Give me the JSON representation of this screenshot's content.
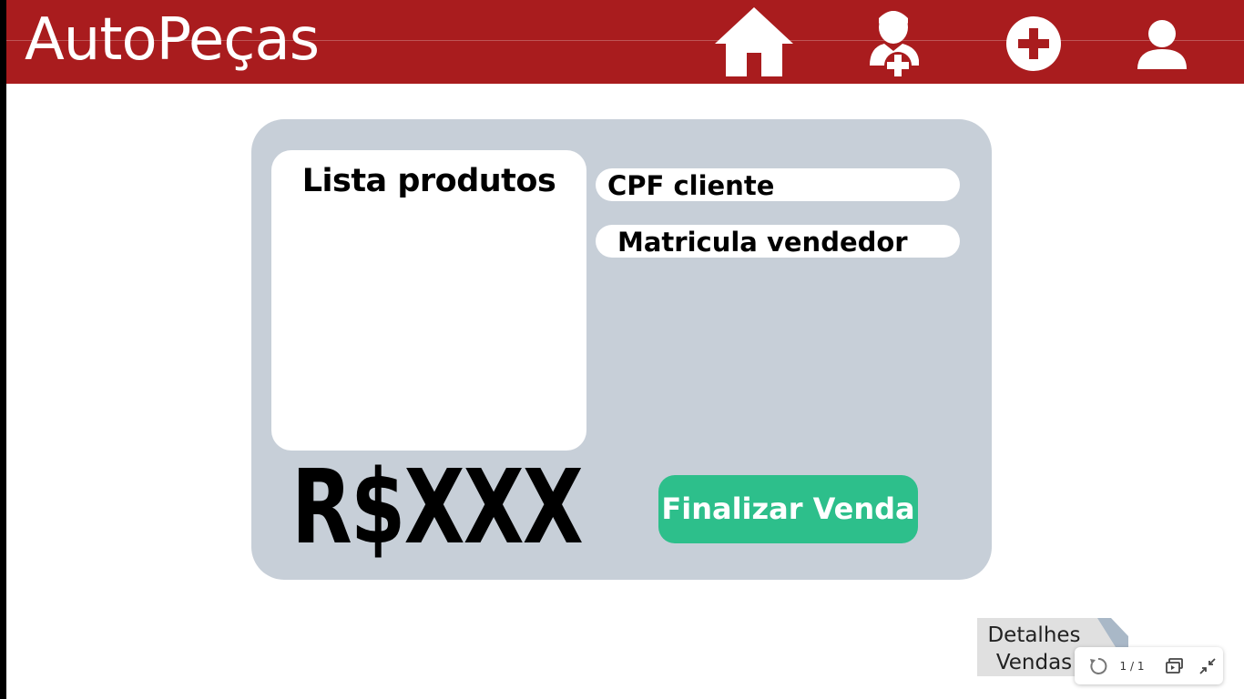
{
  "header": {
    "app_title": "AutoPeças",
    "nav": [
      {
        "icon": "home-icon"
      },
      {
        "icon": "add-user-icon"
      },
      {
        "icon": "add-circle-icon"
      },
      {
        "icon": "user-profile-icon"
      }
    ],
    "background_color": "#a91c1e"
  },
  "sale_form": {
    "product_list_title": "Lista produtos",
    "cpf_label": "CPF cliente",
    "seller_id_label": "Matricula vendedor",
    "total": "R$XXX",
    "finish_button": "Finalizar Venda",
    "finish_button_color": "#2dbf8b",
    "card_color": "#c7cfd8"
  },
  "footer": {
    "details_line1": "Detalhes",
    "details_line2": "Vendas"
  },
  "viewer": {
    "page_counter": "1 / 1",
    "icons": [
      "rotate-icon",
      "present-icon",
      "collapse-icon"
    ]
  }
}
